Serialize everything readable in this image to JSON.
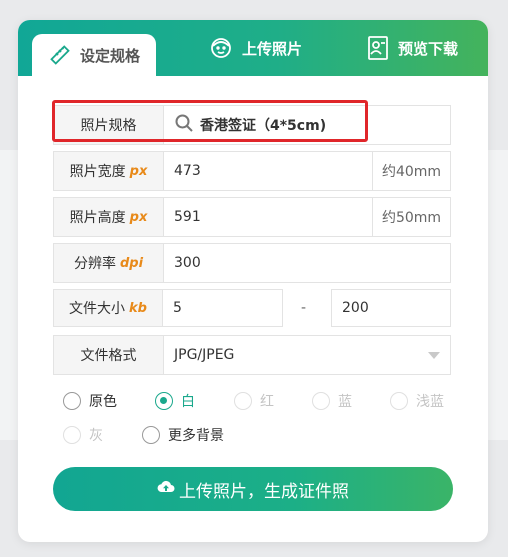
{
  "tabs": [
    {
      "label": "设定规格",
      "icon": "ruler-pencil-icon"
    },
    {
      "label": "上传照片",
      "icon": "face-icon"
    },
    {
      "label": "预览下载",
      "icon": "id-card-icon"
    }
  ],
  "spec": {
    "label": "照片规格",
    "value": "香港签证（4*5cm)",
    "icon": "search-icon"
  },
  "width": {
    "label": "照片宽度",
    "unit_tag": "px",
    "value": "473",
    "suffix": "约40mm"
  },
  "height": {
    "label": "照片高度",
    "unit_tag": "px",
    "value": "591",
    "suffix": "约50mm"
  },
  "resolution": {
    "label": "分辨率",
    "unit_tag": "dpi",
    "value": "300"
  },
  "filesize": {
    "label": "文件大小",
    "unit_tag": "kb",
    "min": "5",
    "separator": "-",
    "max": "200"
  },
  "format": {
    "label": "文件格式",
    "value": "JPG/JPEG"
  },
  "background_colors": [
    {
      "label": "原色",
      "state": "normal"
    },
    {
      "label": "白",
      "state": "checked"
    },
    {
      "label": "红",
      "state": "dim"
    },
    {
      "label": "蓝",
      "state": "dim"
    },
    {
      "label": "浅蓝",
      "state": "dim"
    },
    {
      "label": "灰",
      "state": "dim"
    },
    {
      "label": "更多背景",
      "state": "normal"
    }
  ],
  "upload_button": {
    "label": "上传照片，生成证件照",
    "icon": "cloud-upload-icon"
  },
  "colors": {
    "accent": "#1aa88c",
    "highlight": "#e0262a",
    "unit_tag": "#e88a1a"
  }
}
